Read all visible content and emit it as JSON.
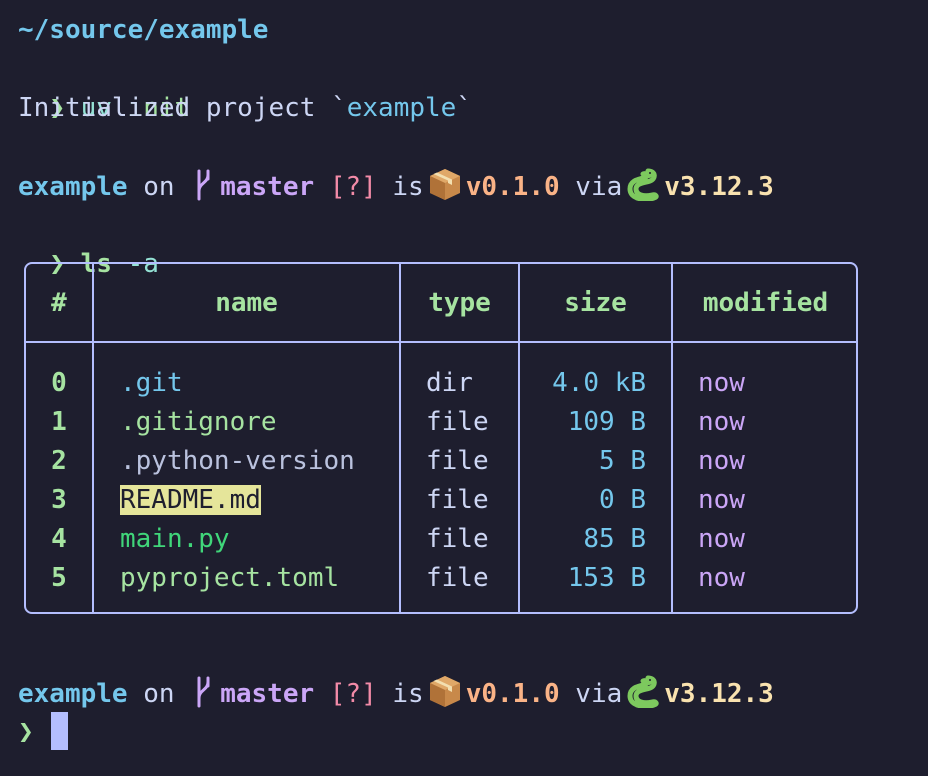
{
  "prompt1": {
    "cwd": "~/source/example",
    "symbol": "❯",
    "command": "uv",
    "args": "init",
    "output_prefix": "Initialized project `",
    "output_name": "example",
    "output_suffix": "`"
  },
  "prompt_status": {
    "dir": "example",
    "on_word": "on",
    "branch_icon": "git-branch-icon",
    "branch": "master",
    "git_status": "[?]",
    "is_word": "is",
    "package_icon": "package-icon",
    "version": "v0.1.0",
    "via_word": "via",
    "python_icon": "python-icon",
    "python_version": "v3.12.3"
  },
  "prompt2": {
    "symbol": "❯",
    "command": "ls",
    "args": "-a"
  },
  "ls_table": {
    "headers": [
      "#",
      "name",
      "type",
      "size",
      "modified"
    ],
    "rows": [
      {
        "index": "0",
        "name": ".git",
        "type": "dir",
        "size": "4.0 kB",
        "modified": "now",
        "name_color": "#74c7ec",
        "highlight": false
      },
      {
        "index": "1",
        "name": ".gitignore",
        "type": "file",
        "size": "109 B",
        "modified": "now",
        "name_color": "#a6e3a1",
        "highlight": false
      },
      {
        "index": "2",
        "name": ".python-version",
        "type": "file",
        "size": "5 B",
        "modified": "now",
        "name_color": "#bac2de",
        "highlight": false
      },
      {
        "index": "3",
        "name": "README.md",
        "type": "file",
        "size": "0 B",
        "modified": "now",
        "name_color": "#1e1e2e",
        "highlight": true
      },
      {
        "index": "4",
        "name": "main.py",
        "type": "file",
        "size": "85 B",
        "modified": "now",
        "name_color": "#40d67a",
        "highlight": false
      },
      {
        "index": "5",
        "name": "pyproject.toml",
        "type": "file",
        "size": "153 B",
        "modified": "now",
        "name_color": "#a6e3a1",
        "highlight": false
      }
    ]
  },
  "prompt3": {
    "symbol": "❯"
  },
  "colors": {
    "background": "#1e1e2e",
    "border": "#b4befe",
    "highlight": "#e5e59a"
  }
}
